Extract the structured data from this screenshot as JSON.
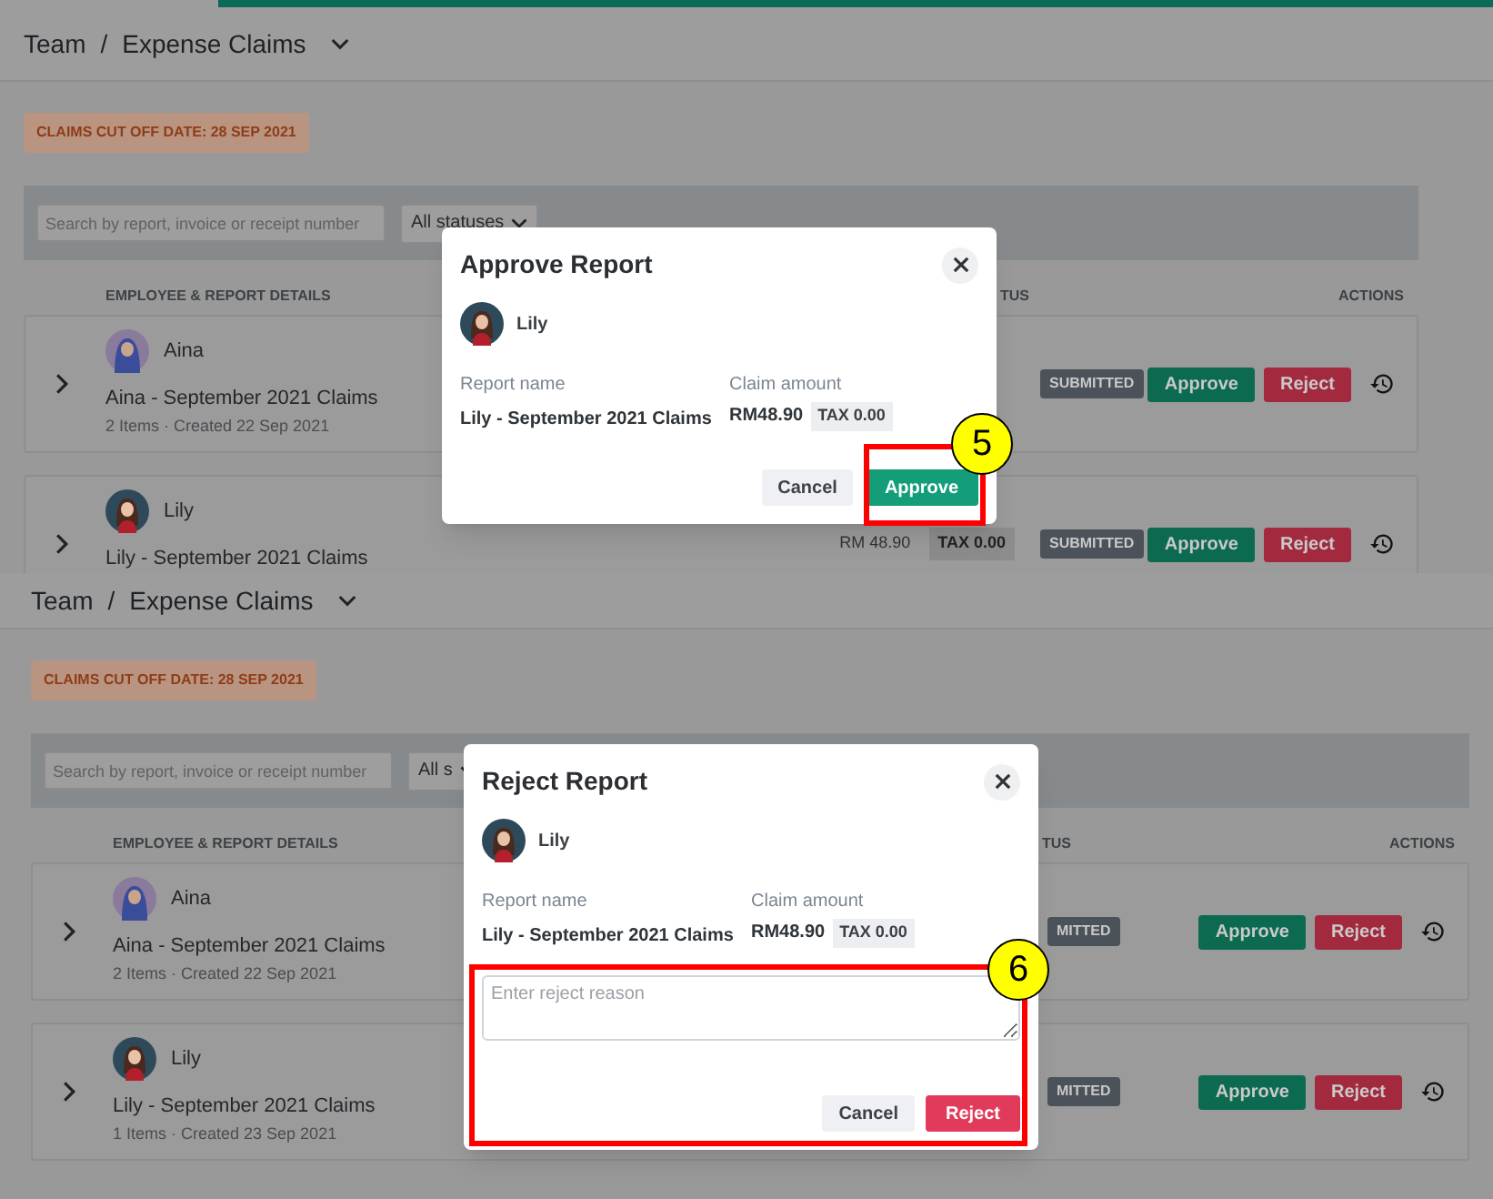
{
  "panels": [
    {
      "kind": "approve",
      "top_bar": true,
      "breadcrumb": {
        "parent": "Team",
        "separator": "/",
        "title": "Expense Claims"
      },
      "cutoff": "CLAIMS CUT OFF DATE: 28 SEP 2021",
      "search": {
        "placeholder": "Search by report, invoice or receipt number"
      },
      "status_filter": "All statuses",
      "columns": [
        "EMPLOYEE & REPORT DETAILS",
        "TUS",
        "ACTIONS"
      ],
      "rows": [
        {
          "kind": "hijab",
          "name": "Aina",
          "title": "Aina - September 2021 Claims",
          "meta": "2 Items · Created 22 Sep 2021",
          "status": "SUBMITTED",
          "actions": [
            "Approve",
            "Reject"
          ]
        },
        {
          "kind": "hair",
          "name": "Lily",
          "title": "Lily - September 2021 Claims",
          "amount": "RM 48.90",
          "tax": "TAX 0.00",
          "status": "SUBMITTED",
          "actions": [
            "Approve",
            "Reject"
          ]
        }
      ],
      "dialog": {
        "title": "Approve Report",
        "employee": "Lily",
        "report_label": "Report name",
        "report_name": "Lily - September 2021 Claims",
        "amount_label": "Claim amount",
        "amount": "RM48.90",
        "tax": "TAX 0.00",
        "cancel": "Cancel",
        "confirm": "Approve"
      },
      "callout": "5"
    },
    {
      "kind": "reject",
      "top_bar": false,
      "breadcrumb": {
        "parent": "Team",
        "separator": "/",
        "title": "Expense Claims"
      },
      "cutoff": "CLAIMS CUT OFF DATE: 28 SEP 2021",
      "search": {
        "placeholder": "Search by report, invoice or receipt number"
      },
      "status_filter": "All s",
      "columns": [
        "EMPLOYEE & REPORT DETAILS",
        "TUS",
        "ACTIONS"
      ],
      "rows": [
        {
          "kind": "hijab",
          "name": "Aina",
          "title": "Aina - September 2021 Claims",
          "meta": "2 Items · Created 22 Sep 2021",
          "status": "MITTED",
          "actions": [
            "Approve",
            "Reject"
          ]
        },
        {
          "kind": "hair",
          "name": "Lily",
          "title": "Lily - September 2021 Claims",
          "meta": "1 Items · Created 23 Sep 2021",
          "status": "MITTED",
          "actions": [
            "Approve",
            "Reject"
          ]
        }
      ],
      "dialog": {
        "title": "Reject Report",
        "employee": "Lily",
        "report_label": "Report name",
        "report_name": "Lily - September 2021 Claims",
        "amount_label": "Claim amount",
        "amount": "RM48.90",
        "tax": "TAX 0.00",
        "reason_placeholder": "Enter reject reason",
        "cancel": "Cancel",
        "confirm": "Reject"
      },
      "callout": "6"
    }
  ]
}
